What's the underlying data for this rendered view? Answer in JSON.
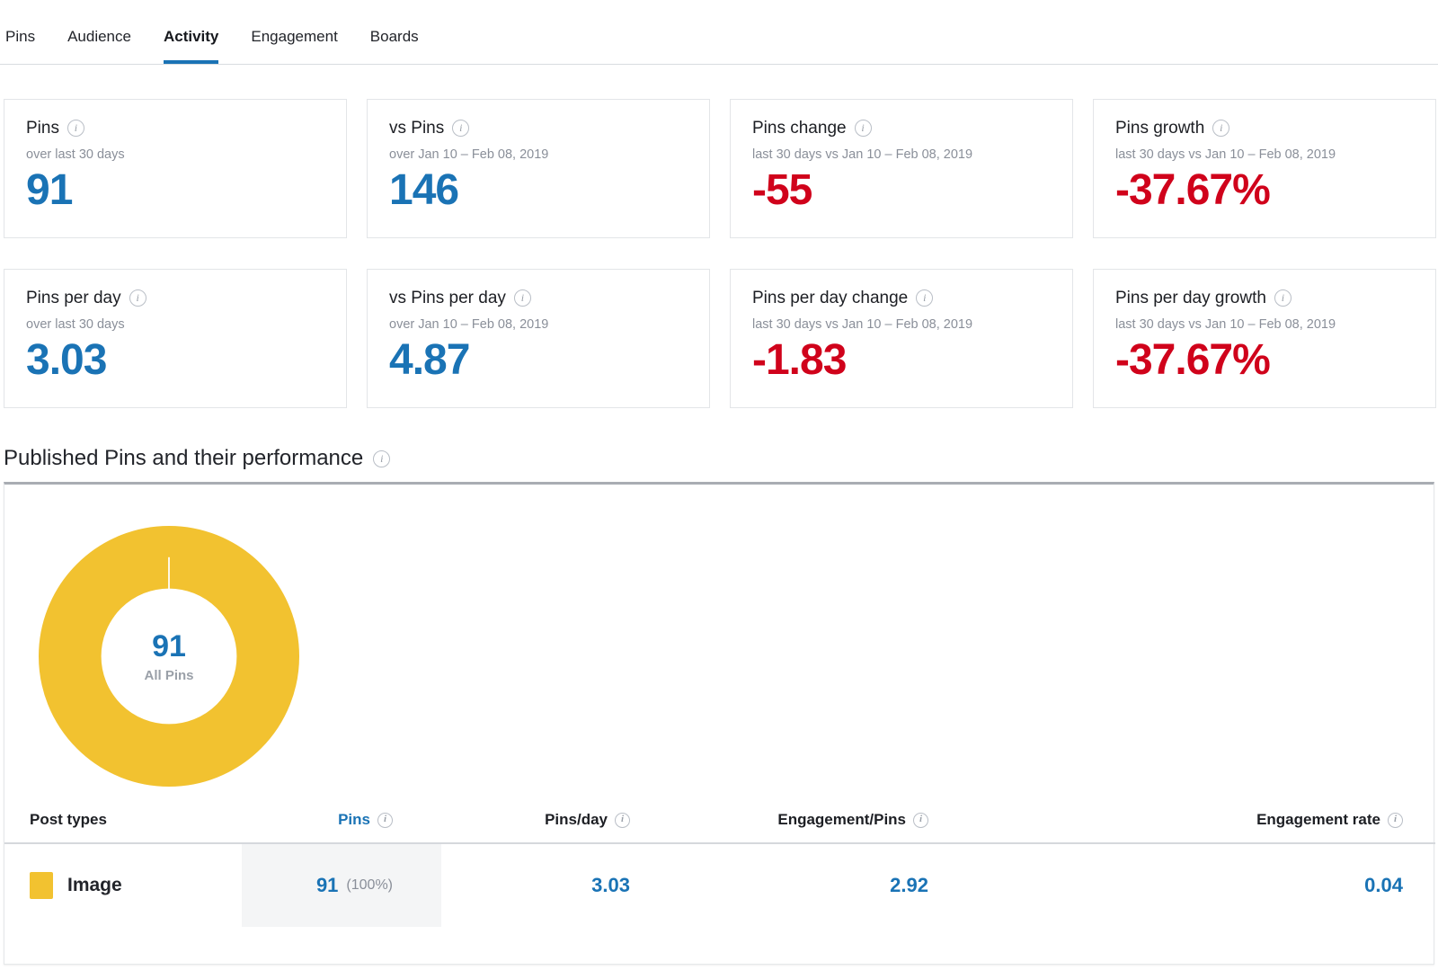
{
  "tabs": [
    {
      "label": "Pins",
      "active": false
    },
    {
      "label": "Audience",
      "active": false
    },
    {
      "label": "Activity",
      "active": true
    },
    {
      "label": "Engagement",
      "active": false
    },
    {
      "label": "Boards",
      "active": false
    }
  ],
  "kpi_cards": [
    {
      "title": "Pins",
      "sub": "over last 30 days",
      "value": "91",
      "tone": "blue"
    },
    {
      "title": "vs Pins",
      "sub": "over Jan 10 – Feb 08, 2019",
      "value": "146",
      "tone": "blue"
    },
    {
      "title": "Pins change",
      "sub": "last 30 days vs Jan 10 – Feb 08, 2019",
      "value": "-55",
      "tone": "red"
    },
    {
      "title": "Pins growth",
      "sub": "last 30 days vs Jan 10 – Feb 08, 2019",
      "value": "-37.67%",
      "tone": "red"
    },
    {
      "title": "Pins per day",
      "sub": "over last 30 days",
      "value": "3.03",
      "tone": "blue"
    },
    {
      "title": "vs Pins per day",
      "sub": "over Jan 10 – Feb 08, 2019",
      "value": "4.87",
      "tone": "blue"
    },
    {
      "title": "Pins per day change",
      "sub": "last 30 days vs Jan 10 – Feb 08, 2019",
      "value": "-1.83",
      "tone": "red"
    },
    {
      "title": "Pins per day growth",
      "sub": "last 30 days vs Jan 10 – Feb 08, 2019",
      "value": "-37.67%",
      "tone": "red"
    }
  ],
  "section": {
    "title": "Published Pins and their performance"
  },
  "donut": {
    "center_value": "91",
    "center_label": "All Pins"
  },
  "table": {
    "headers": [
      {
        "label": "Post types",
        "has_info": false,
        "active": false
      },
      {
        "label": "Pins",
        "has_info": true,
        "active": true
      },
      {
        "label": "Pins/day",
        "has_info": true,
        "active": false
      },
      {
        "label": "Engagement/Pins",
        "has_info": true,
        "active": false
      },
      {
        "label": "Engagement rate",
        "has_info": true,
        "active": false
      }
    ],
    "rows": [
      {
        "type": "Image",
        "swatch_color": "#F2C230",
        "pins": "91",
        "pins_pct": "(100%)",
        "pins_per_day": "3.03",
        "engagement_per_pins": "2.92",
        "engagement_rate": "0.04"
      }
    ]
  },
  "chart_data": {
    "type": "pie",
    "title": "Published Pins and their performance",
    "categories": [
      "Image"
    ],
    "values": [
      91
    ],
    "percentages": [
      100
    ],
    "colors": [
      "#F2C230"
    ],
    "center_value": 91,
    "center_label": "All Pins",
    "legend_position": "table-below",
    "donut": true
  },
  "colors": {
    "accent_blue": "#1A73B5",
    "negative_red": "#D0021B",
    "donut_yellow": "#F2C230",
    "muted_gray": "#8A8F99",
    "cell_highlight": "#F4F5F6"
  }
}
